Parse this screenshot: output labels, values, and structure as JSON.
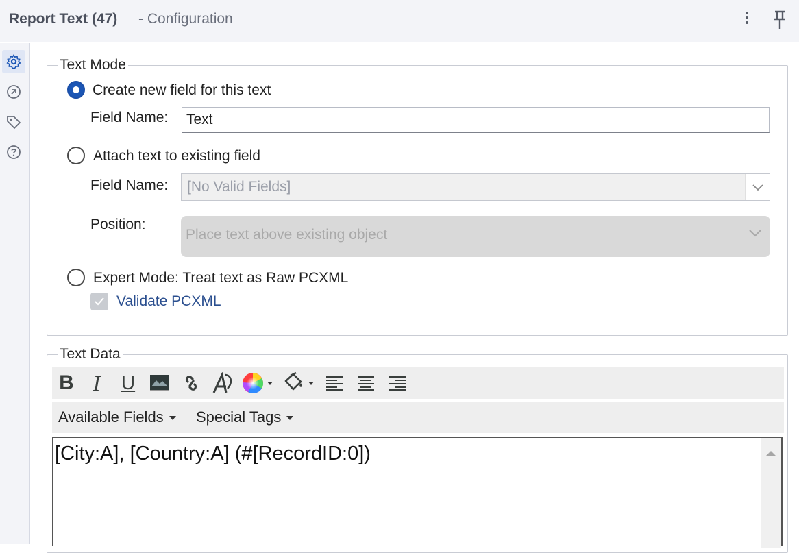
{
  "header": {
    "title": "Report Text (47)",
    "subtitle": "- Configuration"
  },
  "rail": {
    "items": [
      {
        "icon": "gear-icon",
        "active": true
      },
      {
        "icon": "navigate-icon",
        "active": false
      },
      {
        "icon": "tag-icon",
        "active": false
      },
      {
        "icon": "help-icon",
        "active": false
      }
    ]
  },
  "text_mode": {
    "legend": "Text Mode",
    "option_new": "Create new field for this text",
    "field_name_label": "Field Name:",
    "field_name_value": "Text",
    "option_attach": "Attach text to existing field",
    "attach_field_label": "Field Name:",
    "attach_field_value": "[No Valid Fields]",
    "position_label": "Position:",
    "position_value": "Place text above existing object",
    "option_expert": "Expert Mode: Treat text as Raw PCXML",
    "validate_label": "Validate PCXML",
    "selected_option": "create_new",
    "validate_checked": true
  },
  "text_data": {
    "legend": "Text Data",
    "toolbar": [
      "bold-icon",
      "italic-icon",
      "underline-icon",
      "image-icon",
      "link-icon",
      "font-icon",
      "color-picker-icon",
      "fill-color-icon",
      "align-left-icon",
      "align-center-icon",
      "align-right-icon"
    ],
    "available_fields": "Available Fields",
    "special_tags": "Special Tags",
    "content": "[City:A], [Country:A] (#[RecordID:0])"
  }
}
